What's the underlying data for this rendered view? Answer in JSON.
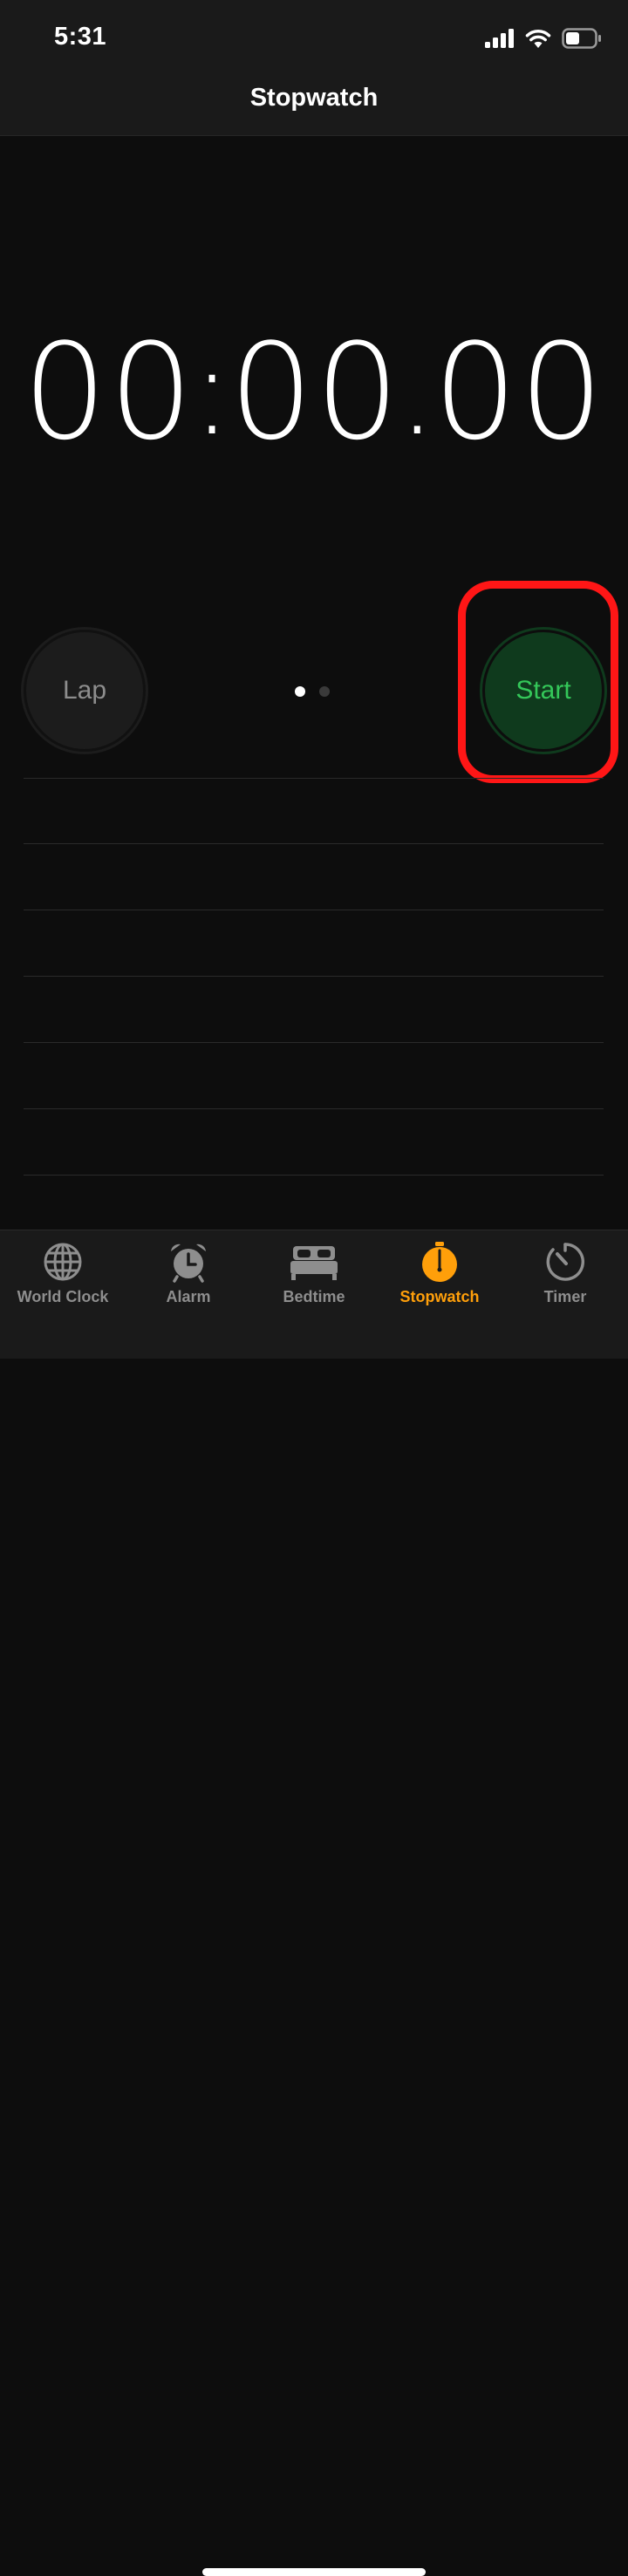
{
  "status_bar": {
    "time": "5:31",
    "icons": [
      "signal-icon",
      "wifi-icon",
      "battery-icon"
    ]
  },
  "nav": {
    "title": "Stopwatch"
  },
  "stopwatch": {
    "minutes": "00",
    "seconds": "00",
    "hundredths": "00",
    "colon": ":",
    "dot": "."
  },
  "controls": {
    "lap_label": "Lap",
    "start_label": "Start",
    "page_dots": {
      "count": 2,
      "active_index": 0
    }
  },
  "tabs": [
    {
      "label": "World Clock",
      "icon": "globe-icon",
      "active": false
    },
    {
      "label": "Alarm",
      "icon": "alarm-clock-icon",
      "active": false
    },
    {
      "label": "Bedtime",
      "icon": "bed-icon",
      "active": false
    },
    {
      "label": "Stopwatch",
      "icon": "stopwatch-icon",
      "active": true
    },
    {
      "label": "Timer",
      "icon": "timer-icon",
      "active": false
    }
  ],
  "colors": {
    "accent": "#ff9f0a",
    "start_green": "#34c759",
    "highlight": "#ff1616"
  }
}
